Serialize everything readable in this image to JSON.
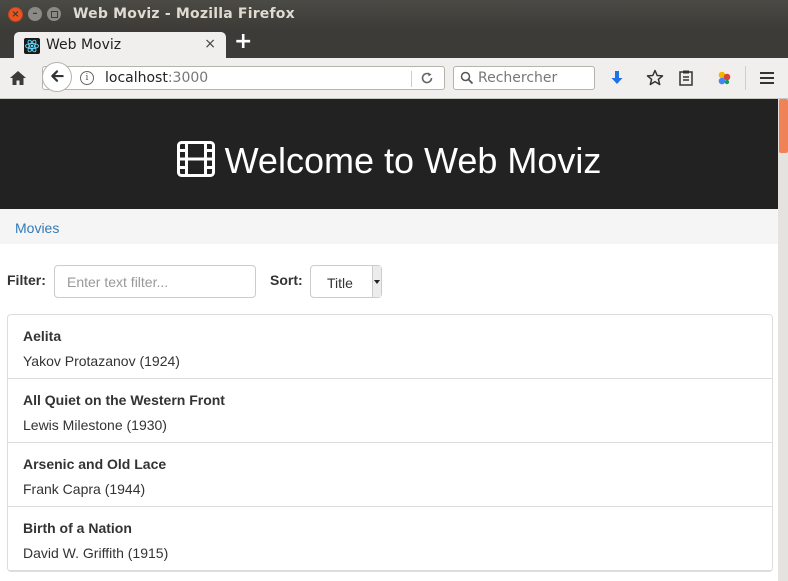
{
  "window": {
    "title": "Web Moviz - Mozilla Firefox"
  },
  "tab": {
    "title": "Web Moviz",
    "close": "×"
  },
  "nav": {
    "new_tab": "+",
    "url_host": "localhost",
    "url_port": ":3000",
    "search_placeholder": "Rechercher"
  },
  "icons": {
    "home": "home-icon",
    "back": "back-arrow-icon",
    "info": "info-icon",
    "reload": "reload-icon",
    "search": "search-icon",
    "download": "download-icon",
    "bookmark": "star-icon",
    "reader": "clipboard-icon",
    "extension": "colorful-dots-icon",
    "menu": "hamburger-menu-icon",
    "film": "film-icon"
  },
  "colors": {
    "accent": "#e95420",
    "link": "#337ab7",
    "header_bg": "#222222",
    "download": "#1b73e8"
  },
  "page": {
    "heading": "Welcome to Web Moviz",
    "breadcrumb": "Movies",
    "filter_label": "Filter:",
    "filter_placeholder": "Enter text filter...",
    "sort_label": "Sort:",
    "sort_value": "Title",
    "movies": [
      {
        "title": "Aelita",
        "subtitle": "Yakov Protazanov (1924)"
      },
      {
        "title": "All Quiet on the Western Front",
        "subtitle": "Lewis Milestone (1930)"
      },
      {
        "title": "Arsenic and Old Lace",
        "subtitle": "Frank Capra (1944)"
      },
      {
        "title": "Birth of a Nation",
        "subtitle": "David W. Griffith (1915)"
      }
    ]
  }
}
